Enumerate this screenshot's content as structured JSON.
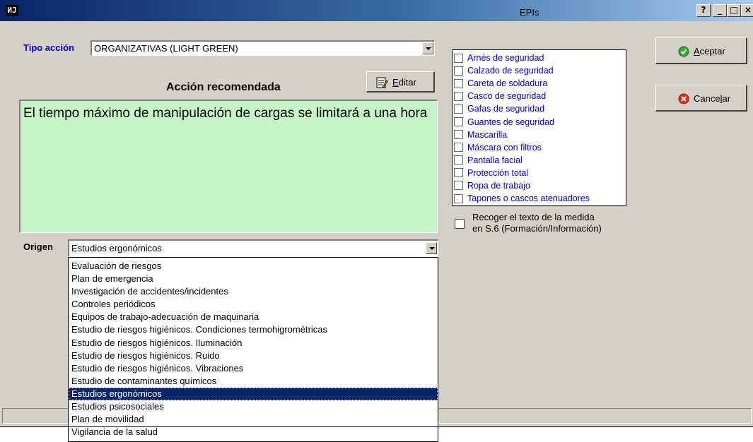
{
  "window": {
    "icon_text": "ИJ",
    "controls": [
      "?",
      "_",
      "□",
      "×"
    ]
  },
  "tipo_accion": {
    "label": "Tipo acción",
    "value": "ORGANIZATIVAS (LIGHT GREEN)"
  },
  "accion": {
    "heading": "Acción recomendada",
    "edit_prefix": "",
    "edit_underlined": "E",
    "edit_rest": "ditar",
    "text": "El tiempo máximo de manipulación de cargas se limitará a una hora",
    "background": "#c8f5c8"
  },
  "epis": {
    "title": "EPIs",
    "items": [
      "Arnés de seguridad",
      "Calzado de seguridad",
      "Careta de soldadura",
      "Casco de seguridad",
      "Gafas de seguridad",
      "Guantes de seguridad",
      "Mascarilla",
      "Máscara con filtros",
      "Pantalla facial",
      "Protección total",
      "Ropa de trabajo",
      "Tapones o cascos atenuadores"
    ],
    "color": "#0000cc"
  },
  "recoger": {
    "line1": "Recoger el texto de la medida",
    "line2": "en S.6 (Formación/Información)"
  },
  "buttons": {
    "aceptar_underlined": "A",
    "aceptar_rest": "ceptar",
    "cancelar_prefix": "Cance",
    "cancelar_underlined": "l",
    "cancelar_rest": "ar"
  },
  "origen": {
    "label": "Origen",
    "value": "Estudios ergonómicos",
    "options": [
      "Evaluación de riesgos",
      "Plan de emergencia",
      "Investigación de accidentes/incidentes",
      "Controles periódicos",
      "Equipos de trabajo-adecuación de maquinaria",
      "Estudio de riesgos higiénicos. Condiciones termohigrométricas",
      "Estudio de riesgos higiénicos. Iluminación",
      "Estudio de riesgos higiénicos. Ruido",
      "Estudio de riesgos higiénicos. Vibraciones",
      "Estudio de contaminantes químicos",
      "Estudios ergonómicos",
      "Estudios psicosociales",
      "Plan de movilidad",
      "Vigilancia de la salud"
    ],
    "selected_index": 10
  }
}
